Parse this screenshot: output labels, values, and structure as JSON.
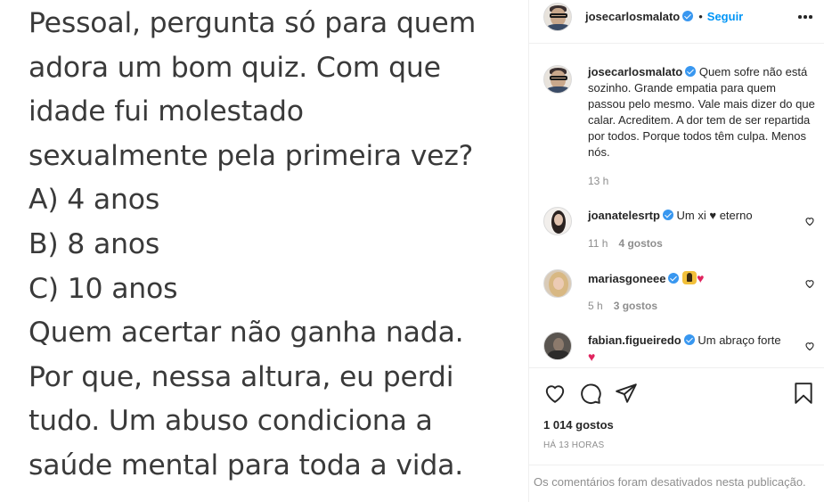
{
  "post": {
    "lines": [
      "Pessoal, pergunta só para quem",
      "adora um bom quiz. Com que",
      "idade fui molestado",
      "sexualmente pela primeira vez?",
      "A) 4 anos",
      "B) 8 anos",
      "C) 10 anos",
      "Quem acertar não ganha nada.",
      "Por que, nessa altura, eu perdi",
      "tudo. Um abuso condiciona a",
      "saúde mental para toda a vida."
    ]
  },
  "header": {
    "username": "josecarlosmalato",
    "separator": "•",
    "follow_label": "Seguir"
  },
  "caption": {
    "username": "josecarlosmalato",
    "text": "Quem sofre não está sozinho. Grande empatia para quem passou pelo mesmo. Vale mais dizer do que calar. Acreditem. A dor tem de ser repartida por todos. Porque todos têm culpa. Menos nós.",
    "time": "13 h"
  },
  "comments": [
    {
      "username": "joanatelesrtp",
      "text": "Um xi ♥ eterno",
      "time": "11 h",
      "likes": "4 gostos"
    },
    {
      "username": "mariasgoneee",
      "text": "",
      "time": "5 h",
      "likes": "3 gostos"
    },
    {
      "username": "fabian.figueiredo",
      "text": "Um abraço forte",
      "time": "",
      "likes": ""
    }
  ],
  "footer": {
    "likes_count": "1 014 gostos",
    "time_ago": "HÁ 13 HORAS",
    "disabled_note": "Os comentários foram desativados nesta publicação."
  },
  "icons": {
    "verified": "verified-badge-icon",
    "like": "heart-icon",
    "comment": "comment-bubble-icon",
    "share": "paper-plane-icon",
    "save": "bookmark-icon",
    "more": "more-options-icon"
  },
  "colors": {
    "accent": "#0095f6",
    "verified": "#3897f0",
    "heart_red": "#e0245e",
    "muted": "#8e8e8e"
  }
}
